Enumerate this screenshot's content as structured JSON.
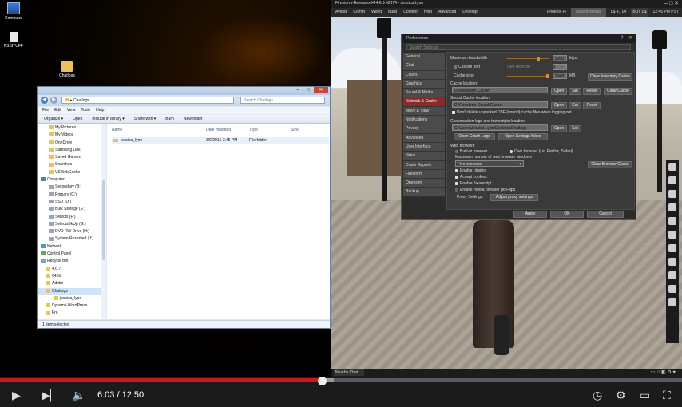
{
  "desktop": {
    "icons": [
      {
        "label": "Computer"
      },
      {
        "label": "FS STUFF"
      },
      {
        "label": "Chatlogs"
      }
    ]
  },
  "explorer": {
    "address": "Chatlogs",
    "search_placeholder": "Search Chatlogs",
    "menu": [
      "File",
      "Edit",
      "View",
      "Tools",
      "Help"
    ],
    "toolbar": [
      "Organize ▾",
      "Open",
      "Include in library ▾",
      "Share with ▾",
      "Burn",
      "New folder"
    ],
    "nav_items": [
      {
        "label": "My Pictures",
        "type": "folder"
      },
      {
        "label": "My Videos",
        "type": "folder"
      },
      {
        "label": "OneDrive",
        "type": "folder"
      },
      {
        "label": "Samsung Link",
        "type": "folder"
      },
      {
        "label": "Saved Games",
        "type": "folder"
      },
      {
        "label": "Searches",
        "type": "folder"
      },
      {
        "label": "VSWebCache",
        "type": "folder"
      },
      {
        "label": "Computer",
        "type": "computer"
      },
      {
        "label": "Secondary (B:)",
        "type": "drive"
      },
      {
        "label": "Primary (C:)",
        "type": "drive"
      },
      {
        "label": "SSD (D:)",
        "type": "drive"
      },
      {
        "label": "Bulk Storage (E:)",
        "type": "drive"
      },
      {
        "label": "Selects (F:)",
        "type": "drive"
      },
      {
        "label": "SelectsBkUp (G:)",
        "type": "drive"
      },
      {
        "label": "DVD RW Drive (H:)",
        "type": "drive"
      },
      {
        "label": "System Reserved (J:)",
        "type": "drive"
      },
      {
        "label": "Network",
        "type": "network"
      },
      {
        "label": "Control Panel",
        "type": "panel"
      },
      {
        "label": "Recycle Bin",
        "type": "bin"
      },
      {
        "label": "4.6.7",
        "type": "folder"
      },
      {
        "label": "64Bit",
        "type": "folder"
      },
      {
        "label": "Adobe",
        "type": "folder"
      },
      {
        "label": "Chatlogs",
        "type": "folder"
      },
      {
        "label": "jessica_lyon",
        "type": "folder"
      },
      {
        "label": "Dynamii-WordPress",
        "type": "folder"
      },
      {
        "label": "Fro",
        "type": "folder"
      }
    ],
    "columns": {
      "name": "Name",
      "date": "Date modified",
      "type": "Type",
      "size": "Size"
    },
    "files": [
      {
        "name": "jessica_lyon",
        "date": "3/9/2015 3:45 PM",
        "type": "File folder"
      }
    ],
    "status": "1 item selected"
  },
  "viewer": {
    "title": "Firestorm-Releasex64 4.6.9.42974 - Jessica Lyon",
    "menu": [
      "Avatar",
      "Comm",
      "World",
      "Build",
      "Content",
      "Help",
      "Advanced",
      "Develop"
    ],
    "status_right": [
      "Phoenix Fi",
      "Search Menus",
      "L$ 4,708",
      "BUY L$",
      "12:46 PM PST"
    ],
    "nearby_chat": "Nearby Chat"
  },
  "prefs": {
    "title": "Preferences",
    "search_placeholder": "Search Settings",
    "tabs": [
      "General",
      "Chat",
      "Colors",
      "Graphics",
      "Sound & Media",
      "Network & Cache",
      "Move & View",
      "Notifications",
      "Privacy",
      "Advanced",
      "User Interface",
      "Skins",
      "Crash Reports",
      "Firestorm",
      "Opensim",
      "Backup"
    ],
    "selected_tab": 5,
    "max_bandwidth_label": "Maximum bandwidth",
    "max_bandwidth_value": "2200",
    "bandwidth_unit": "kbps",
    "custom_port_label": "Custom port",
    "port_hint": "(Not recomm",
    "port_value": "13000",
    "cache_size_label": "Cache size",
    "cache_size_value": "2048",
    "cache_unit": "MB",
    "clear_inv_cache": "Clear Inventory Cache",
    "cache_location_label": "Cache location:",
    "cache_location": "D:\\Firestorm Cache\\",
    "open": "Open",
    "set": "Set",
    "reset": "Reset",
    "clear_cache": "Clear Cache",
    "sound_cache_label": "Sound Cache location:",
    "sound_cache": "D:\\Firestorm Sound Cache",
    "dont_delete_label": "Don't delete unpacked DSF (sound) cache files when logging out",
    "conv_logs_label": "Conversation logs and transcripts location:",
    "conv_logs": "C:\\Users\\Jessica Lyon\\Desktop\\Chatlogs",
    "open_crash_logs": "Open Crash Logs",
    "open_settings_folder": "Open Settings folder",
    "web_browser_label": "Web browser:",
    "builtin_browser": "Built-in browser",
    "own_browser": "Own browser (i.e. Firefox, Safari)",
    "max_browser_windows_label": "Maximum number of web browser windows",
    "browser_windows_value": "Five windows",
    "clear_browser_cache": "Clear Browser Cache",
    "enable_plugins": "Enable plugins",
    "accept_cookies": "Accept cookies",
    "enable_javascript": "Enable Javascript",
    "enable_popups": "Enable media browser pop-ups",
    "proxy_settings_label": "Proxy Settings:",
    "adjust_proxy": "Adjust proxy settings",
    "apply": "Apply",
    "ok": "OK",
    "cancel": "Cancel"
  },
  "player": {
    "current_time": "6:03",
    "total_time": "12:50",
    "time_separator": "/",
    "progress_fraction": 0.4714,
    "loaded_fraction": 0.49,
    "accent": "#cc181e"
  }
}
